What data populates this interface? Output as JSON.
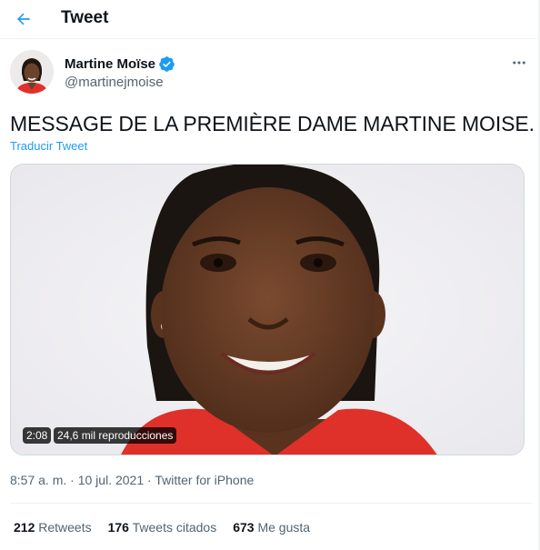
{
  "header": {
    "title": "Tweet"
  },
  "author": {
    "name": "Martine Moïse",
    "handle": "@martinejmoise",
    "verified": true
  },
  "tweet": {
    "text": "MESSAGE DE LA PREMIÈRE DAME MARTINE MOISE.",
    "translate_label": "Traducir Tweet"
  },
  "media": {
    "duration": "2:08",
    "views": "24,6 mil reproducciones"
  },
  "meta": {
    "time": "8:57 a. m.",
    "separator": "·",
    "date": "10 jul. 2021",
    "source": "Twitter for iPhone"
  },
  "stats": {
    "retweets_count": "212",
    "retweets_label": "Retweets",
    "quotes_count": "176",
    "quotes_label": "Tweets citados",
    "likes_count": "673",
    "likes_label": "Me gusta"
  },
  "icons": {
    "back": "arrow-left-icon",
    "verified": "verified-badge-icon",
    "more": "more-horizontal-icon"
  },
  "colors": {
    "accent": "#1d9bf0",
    "text_primary": "#0f1419",
    "text_secondary": "#536471",
    "divider": "#eff3f4",
    "dress_red": "#e0302a"
  }
}
